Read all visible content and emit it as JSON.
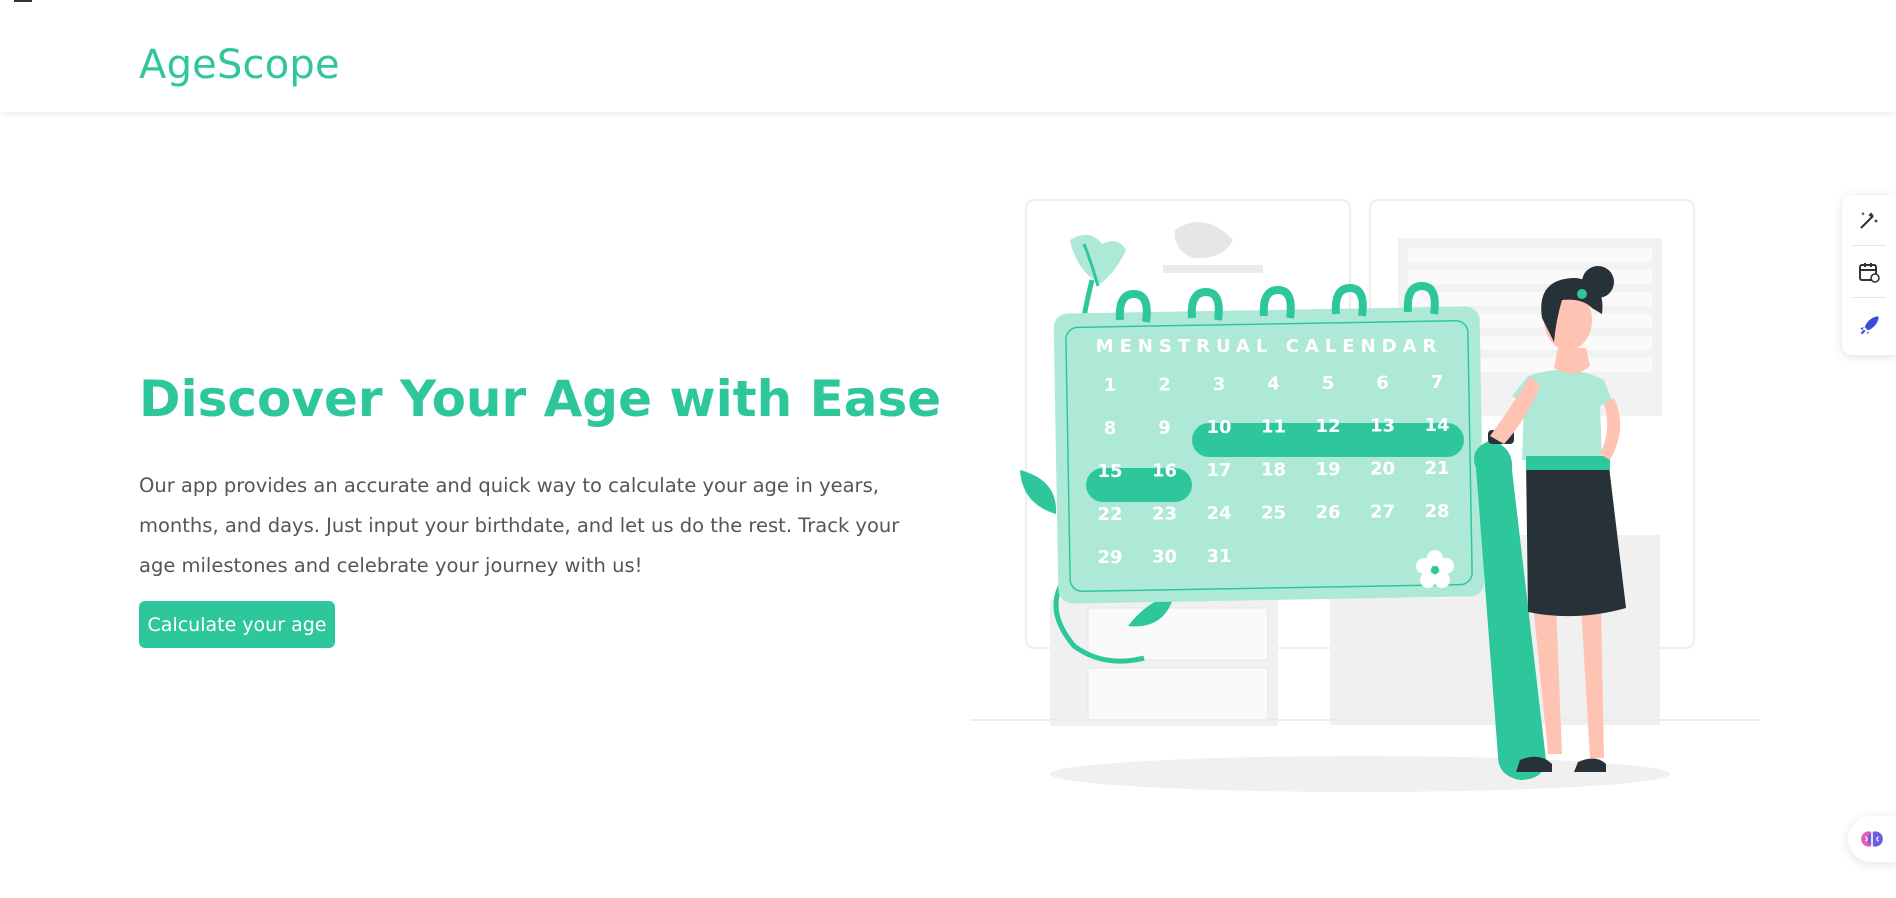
{
  "header": {
    "brand": "AgeScope"
  },
  "hero": {
    "title": "Discover Your Age with Ease",
    "description": "Our app provides an accurate and quick way to calculate your age in years, months, and days. Just input your birthdate, and let us do the rest. Track your age milestones and celebrate your journey with us!",
    "cta_label": "Calculate your age"
  },
  "illustration": {
    "calendar_title": "MENSTRUAL CALENDAR",
    "days": [
      "1",
      "2",
      "3",
      "4",
      "5",
      "6",
      "7",
      "8",
      "9",
      "10",
      "11",
      "12",
      "13",
      "14",
      "15",
      "16",
      "17",
      "18",
      "19",
      "20",
      "21",
      "22",
      "23",
      "24",
      "25",
      "26",
      "27",
      "28",
      "29",
      "30",
      "31"
    ]
  },
  "side_dock": {
    "icons": [
      "magic-wand-icon",
      "calendar-edit-icon",
      "rocket-icon"
    ]
  },
  "floating": {
    "icon": "brain-icon"
  },
  "colors": {
    "accent": "#2ec79b",
    "accent_light": "#aee9d8",
    "dark": "#263238",
    "skin": "#ffc3b4"
  }
}
